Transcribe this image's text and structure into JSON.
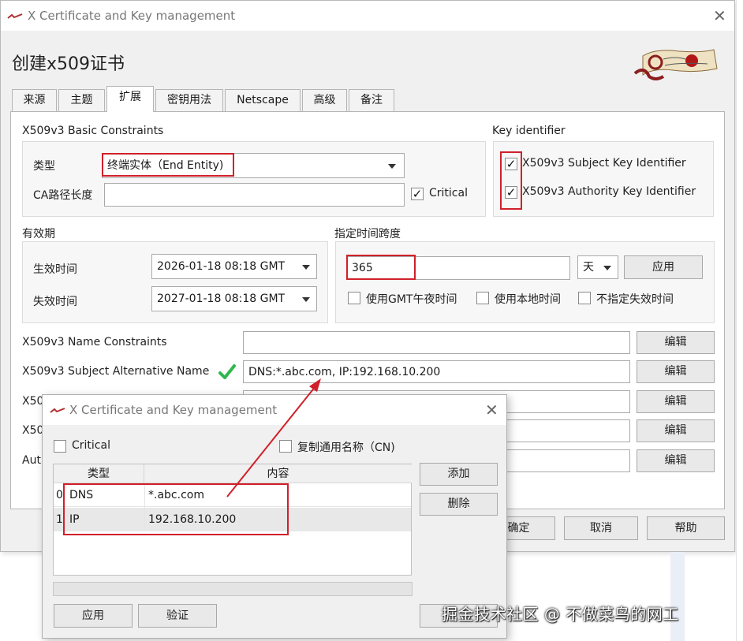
{
  "window": {
    "title": "X Certificate and Key management",
    "heading": "创建x509证书",
    "tabs": [
      "来源",
      "主题",
      "扩展",
      "密钥用法",
      "Netscape",
      "高级",
      "备注"
    ],
    "active_tab": "扩展"
  },
  "basic_constraints": {
    "group_title": "X509v3 Basic Constraints",
    "type_label": "类型",
    "type_value": "终端实体（End Entity)",
    "ca_path_label": "CA路径长度",
    "ca_path_value": "",
    "critical_label": "Critical",
    "critical_checked": true
  },
  "key_identifier": {
    "group_title": "Key identifier",
    "subject_label": "X509v3 Subject Key Identifier",
    "authority_label": "X509v3 Authority Key Identifier"
  },
  "validity": {
    "group_title": "有效期",
    "start_label": "生效时间",
    "start_value": "2026-01-18 08:18 GMT",
    "end_label": "失效时间",
    "end_value": "2027-01-18 08:18 GMT"
  },
  "timespan": {
    "group_title": "指定时间跨度",
    "value": "365",
    "unit": "天",
    "apply_label": "应用",
    "gmt_midnight_label": "使用GMT午夜时间",
    "local_time_label": "使用本地时间",
    "no_expiry_label": "不指定失效时间"
  },
  "extensions": {
    "name_constraints_label": "X509v3 Name Constraints",
    "name_constraints_value": "",
    "san_label": "X509v3 Subject Alternative Name",
    "san_value": "DNS:*.abc.com, IP:192.168.10.200",
    "row3_label": "X50",
    "row4_label": "X50",
    "row5_label": "Aut",
    "edit_label": "编辑"
  },
  "footer": {
    "ok_label": "确定",
    "cancel_label": "取消",
    "help_label": "帮助"
  },
  "dialog": {
    "title": "X Certificate and Key management",
    "critical_label": "Critical",
    "copy_cn_label": "复制通用名称（CN)",
    "col_type": "类型",
    "col_content": "内容",
    "rows": [
      {
        "index": "0",
        "type": "DNS",
        "content": "*.abc.com"
      },
      {
        "index": "1",
        "type": "IP",
        "content": "192.168.10.200"
      }
    ],
    "add_label": "添加",
    "delete_label": "删除",
    "apply_label": "应用",
    "validate_label": "验证"
  },
  "watermark": "掘金技术社区 @ 不做菜鸟的网工",
  "colors": {
    "highlight_red": "#d0202a",
    "check_green": "#2db84d"
  }
}
